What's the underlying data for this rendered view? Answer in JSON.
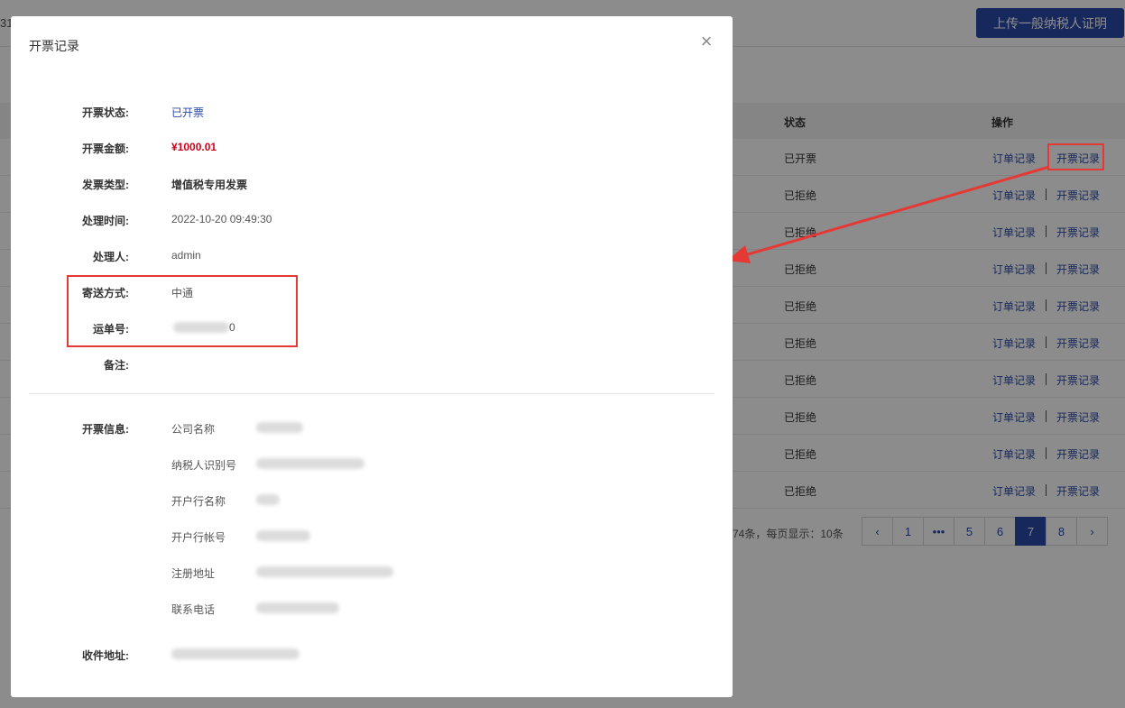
{
  "background": {
    "truncated_text": "31",
    "upload_button": "上传一般纳税人证明",
    "table": {
      "headers": {
        "status": "状态",
        "actions": "操作"
      },
      "rows": [
        {
          "status": "已开票",
          "order_link": "订单记录",
          "invoice_link": "开票记录"
        },
        {
          "status": "已拒绝",
          "order_link": "订单记录",
          "invoice_link": "开票记录"
        },
        {
          "status": "已拒绝",
          "order_link": "订单记录",
          "invoice_link": "开票记录"
        },
        {
          "status": "已拒绝",
          "order_link": "订单记录",
          "invoice_link": "开票记录"
        },
        {
          "status": "已拒绝",
          "order_link": "订单记录",
          "invoice_link": "开票记录"
        },
        {
          "status": "已拒绝",
          "order_link": "订单记录",
          "invoice_link": "开票记录"
        },
        {
          "status": "已拒绝",
          "order_link": "订单记录",
          "invoice_link": "开票记录"
        },
        {
          "status": "已拒绝",
          "order_link": "订单记录",
          "invoice_link": "开票记录"
        },
        {
          "status": "已拒绝",
          "order_link": "订单记录",
          "invoice_link": "开票记录"
        },
        {
          "status": "已拒绝",
          "order_link": "订单记录",
          "invoice_link": "开票记录"
        }
      ]
    },
    "pager": {
      "total_text": "74条，每页显示：10条",
      "pages": [
        "‹",
        "1",
        "•••",
        "5",
        "6",
        "7",
        "8",
        "›"
      ],
      "current": "7"
    }
  },
  "modal": {
    "title": "开票记录",
    "close_icon": "close-icon",
    "fields": {
      "status_label": "开票状态:",
      "status_value": "已开票",
      "amount_label": "开票金额:",
      "amount_value": "¥1000.01",
      "type_label": "发票类型:",
      "type_value": "增值税专用发票",
      "time_label": "处理时间:",
      "time_value": "2022-10-20 09:49:30",
      "handler_label": "处理人:",
      "handler_value": "admin",
      "ship_method_label": "寄送方式:",
      "ship_method_value": "中通",
      "tracking_label": "运单号:",
      "tracking_value": "0",
      "remark_label": "备注:",
      "remark_value": ""
    },
    "invoice_info": {
      "label": "开票信息:",
      "items": [
        "公司名称",
        "纳税人识别号",
        "开户行名称",
        "开户行帐号",
        "注册地址",
        "联系电话"
      ]
    },
    "address_label": "收件地址:"
  },
  "colors": {
    "accent": "#2b4aa8",
    "amount": "#d0021b",
    "annotation": "#e53935"
  }
}
